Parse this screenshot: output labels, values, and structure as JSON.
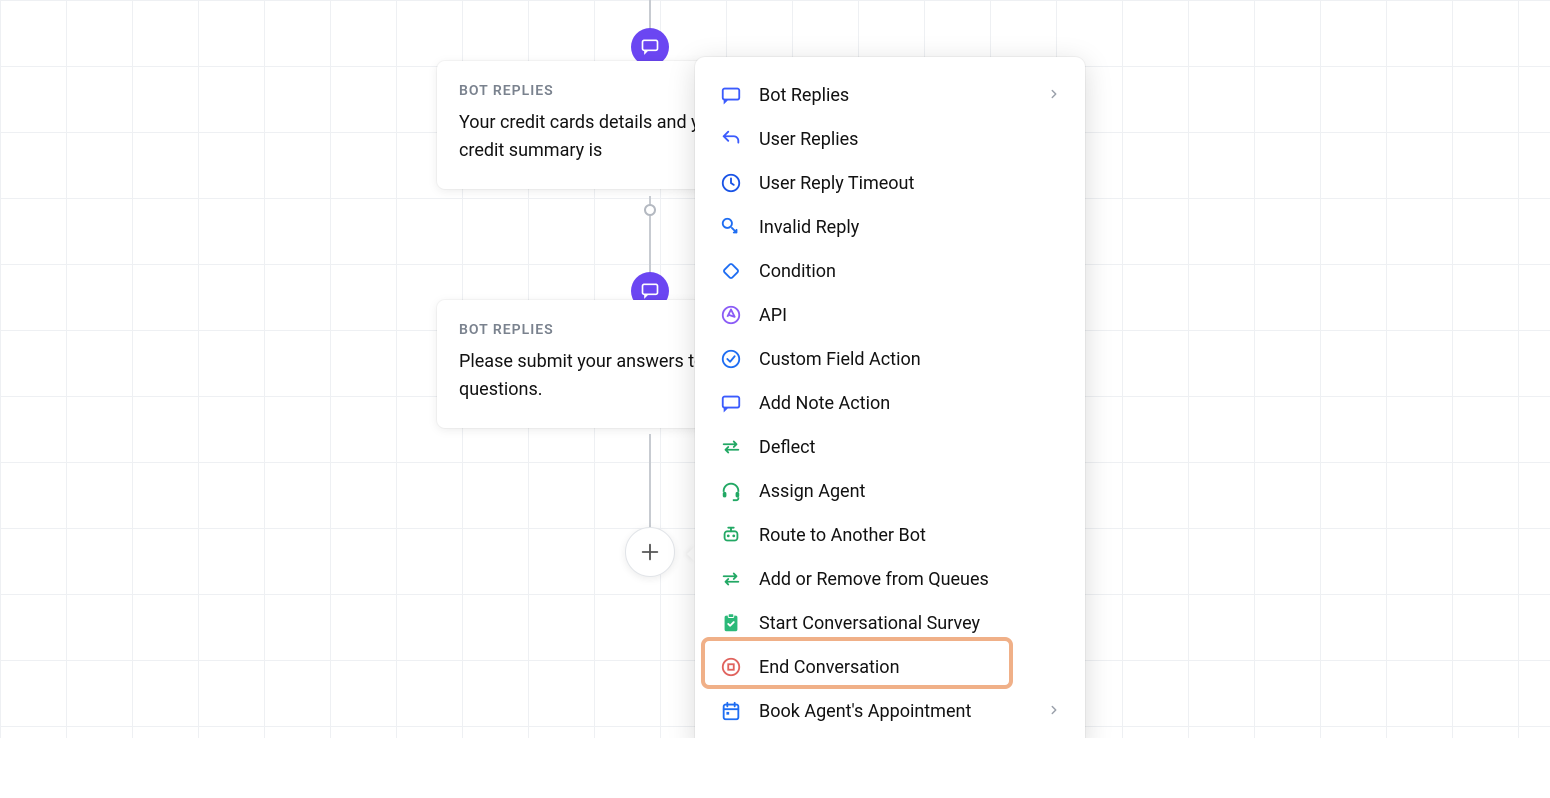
{
  "cards": [
    {
      "header": "BOT REPLIES",
      "body": "Your credit cards details and your available credit summary is"
    },
    {
      "header": "BOT REPLIES",
      "body": "Please submit your answers to the survey questions."
    }
  ],
  "menu": {
    "items": [
      {
        "label": "Bot Replies",
        "icon": "chat-icon",
        "color": "#3b5bfd",
        "chevron": true
      },
      {
        "label": "User Replies",
        "icon": "reply-icon",
        "color": "#3b5bfd"
      },
      {
        "label": "User Reply Timeout",
        "icon": "clock-icon",
        "color": "#1953e6"
      },
      {
        "label": "Invalid Reply",
        "icon": "invalid-icon",
        "color": "#1e6df2"
      },
      {
        "label": "Condition",
        "icon": "diamond-icon",
        "color": "#1e6df2"
      },
      {
        "label": "API",
        "icon": "api-icon",
        "color": "#8b5cf6"
      },
      {
        "label": "Custom Field Action",
        "icon": "check-circle-icon",
        "color": "#1e6df2"
      },
      {
        "label": "Add Note Action",
        "icon": "note-icon",
        "color": "#3b5bfd"
      },
      {
        "label": "Deflect",
        "icon": "arrows-icon",
        "color": "#22a864"
      },
      {
        "label": "Assign Agent",
        "icon": "headset-icon",
        "color": "#22a864"
      },
      {
        "label": "Route to Another Bot",
        "icon": "robot-icon",
        "color": "#22a864"
      },
      {
        "label": "Add or Remove from Queues",
        "icon": "arrows-icon",
        "color": "#22a864"
      },
      {
        "label": "Start Conversational Survey",
        "icon": "clipboard-icon",
        "color": "#2bb979",
        "highlight": true
      },
      {
        "label": "End Conversation",
        "icon": "stop-icon",
        "color": "#e0635e"
      },
      {
        "label": "Book Agent's Appointment",
        "icon": "calendar-icon",
        "color": "#1e6df2",
        "chevron": true
      }
    ]
  }
}
